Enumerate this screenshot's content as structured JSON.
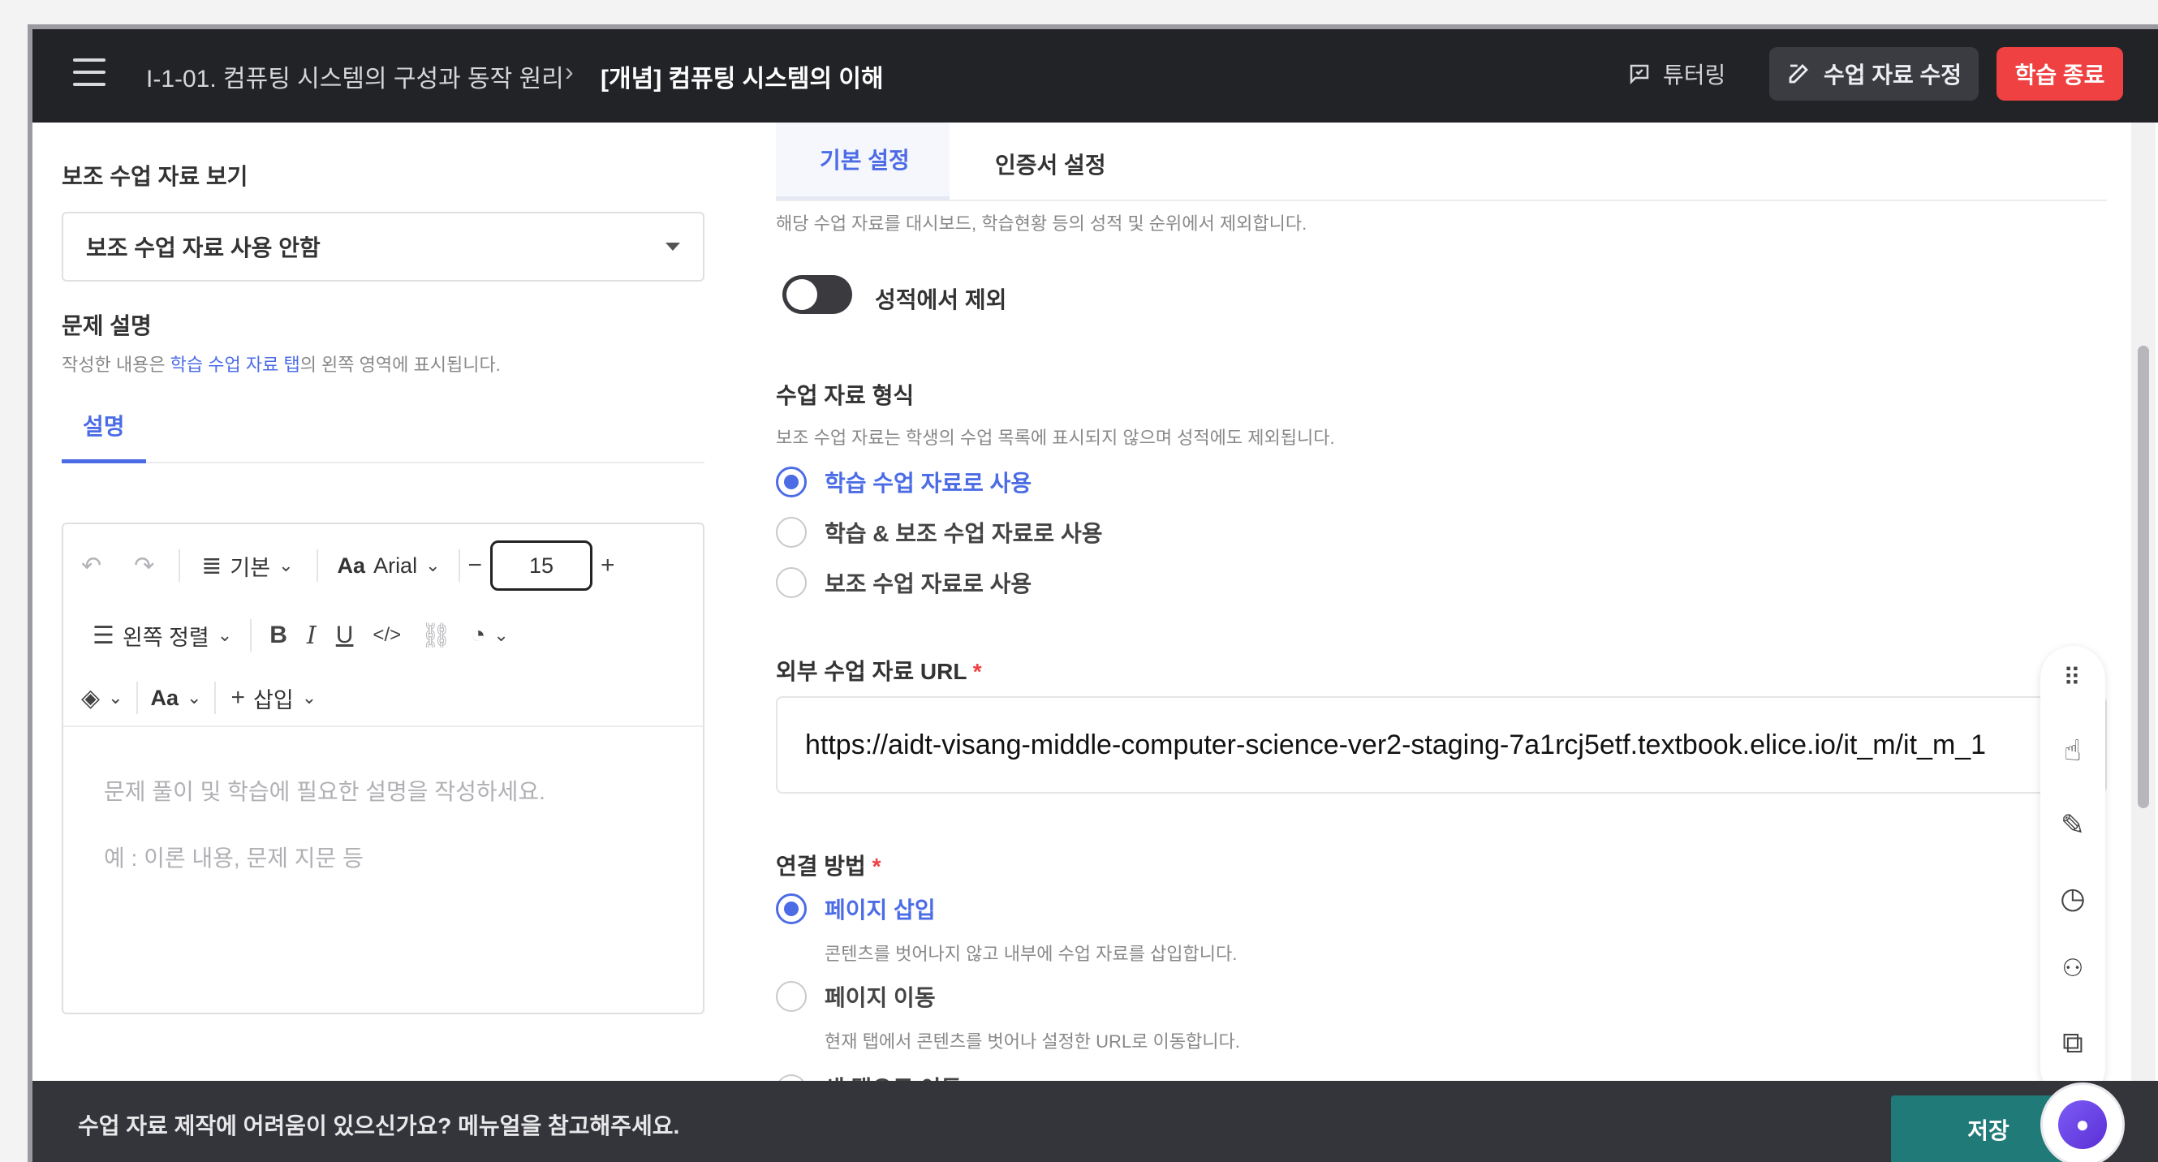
{
  "topbar": {
    "breadcrumb_parent": "I-1-01. 컴퓨팅 시스템의 구성과 동작 원리",
    "breadcrumb_sep": "›",
    "breadcrumb_current": "[개념] 컴퓨팅 시스템의 이해",
    "tutor_label": "튜터링",
    "edit_label": "수업 자료 수정",
    "end_label": "학습 종료"
  },
  "left": {
    "view_label": "보조 수업 자료 보기",
    "select_value": "보조 수업 자료 사용 안함",
    "problem_label": "문제 설명",
    "help_prefix": "작성한 내용은 ",
    "help_link": "학습 수업 자료 탭",
    "help_suffix": "의 왼쪽 영역에 표시됩니다.",
    "desc_tab": "설명",
    "editor": {
      "block_style": "기본",
      "font_icon": "Aa",
      "font_name": "Arial",
      "font_size": "15",
      "align": "왼쪽 정렬",
      "insert": "삽입",
      "case_icon": "Aa",
      "placeholder_1": "문제 풀이 및 학습에 필요한 설명을 작성하세요.",
      "placeholder_2": "예 : 이론 내용, 문제 지문 등"
    }
  },
  "right": {
    "tabs": [
      "기본 설정",
      "인증서 설정"
    ],
    "exclude_help": "해당 수업 자료를 대시보드, 학습현황 등의 성적 및 순위에서 제외합니다.",
    "exclude_label": "성적에서 제외",
    "format_label": "수업 자료 형식",
    "format_help": "보조 수업 자료는 학생의 수업 목록에 표시되지 않으며 성적에도 제외됩니다.",
    "format_options": [
      "학습 수업 자료로 사용",
      "학습 & 보조 수업 자료로 사용",
      "보조 수업 자료로 사용"
    ],
    "url_label": "외부 수업 자료 URL",
    "required_mark": "*",
    "url_value": "https://aidt-visang-middle-computer-science-ver2-staging-7a1rcj5etf.textbook.elice.io/it_m/it_m_1",
    "link_label": "연결 방법",
    "link_options": [
      {
        "label": "페이지 삽입",
        "help": "콘텐츠를 벗어나지 않고 내부에 수업 자료를 삽입합니다."
      },
      {
        "label": "페이지 이동",
        "help": "현재 탭에서 콘텐츠를 벗어나 설정한 URL로 이동합니다."
      },
      {
        "label": "새 탭으로 이동"
      }
    ]
  },
  "bottombar": {
    "help_text": "수업 자료 제작에 어려움이 있으신가요? 메뉴얼을 참고해주세요.",
    "save_label": "저장"
  },
  "colors": {
    "accent": "#4c6ce6",
    "danger": "#ef4141",
    "save": "#1f7a78",
    "topbar": "#222327"
  }
}
